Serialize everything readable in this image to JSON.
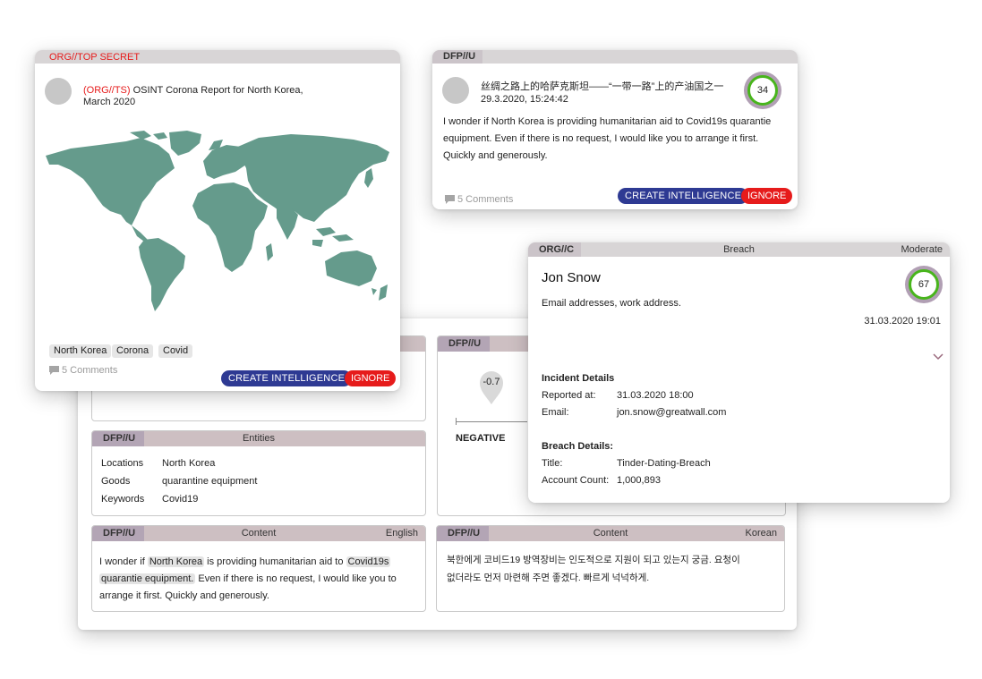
{
  "back_card": {
    "entities": {
      "cls": "DFP//U",
      "title": "Entities",
      "rows": [
        {
          "k": "Locations",
          "v": "North Korea"
        },
        {
          "k": "Goods",
          "v": "quarantine equipment"
        },
        {
          "k": "Keywords",
          "v": "Covid19"
        }
      ]
    },
    "content_en": {
      "cls": "DFP//U",
      "title": "Content",
      "lang": "English",
      "t1": "I wonder if ",
      "h1": "North Korea",
      "t2": " is providing humanitarian aid to ",
      "h2": "Covid19s",
      "h3": "quarantie equipment.",
      "t3": " Even if there is no request, I would like you to",
      "t4": "arrange it first. Quickly and generously."
    },
    "content_ko": {
      "cls": "DFP//U",
      "title": "Content",
      "lang": "Korean",
      "line1": "북한에게 코비드19 방역장비는 인도적으로 지원이 되고 있는지 궁금. 요청이",
      "line2": "없더라도 먼저 마련해 주면 좋겠다. 빠르게 넉넉하게."
    },
    "sentiment": {
      "cls": "DFP//U",
      "value": "-0.7",
      "label": "NEGATIVE"
    }
  },
  "report_card": {
    "classification": "ORG//TOP SECRET",
    "title_prefix": "(ORG//TS)",
    "title_line1": " OSINT Corona Report for North Korea,",
    "title_line2": "March 2020",
    "tags": [
      "North Korea",
      "Corona",
      "Covid"
    ],
    "comments": "5 Comments",
    "create_label": "CREATE INTELLIGENCE",
    "ignore_label": "IGNORE",
    "map_color": "#659b8c"
  },
  "post_card": {
    "classification": "DFP//U",
    "title": "丝绸之路上的哈萨克斯坦——“一带一路”上的产油国之一",
    "timestamp": "29.3.2020, 15:24:42",
    "score": "34",
    "body_line1": "I wonder if North Korea is providing humanitarian aid to Covid19s  quarantie",
    "body_line2": "equipment. Even if there is no request, I would like you to arrange it first.",
    "body_line3": "Quickly and generously.",
    "comments": "5 Comments",
    "create_label": "CREATE INTELLIGENCE",
    "ignore_label": "IGNORE"
  },
  "breach_card": {
    "classification": "ORG//C",
    "type": "Breach",
    "severity": "Moderate",
    "name": "Jon Snow",
    "score": "67",
    "summary": "Email addresses, work address.",
    "date": "31.03.2020 19:01",
    "incident_heading": "Incident Details",
    "reported_label": "Reported at:",
    "reported_value": "31.03.2020 18:00",
    "email_label": "Email:",
    "email_value": "jon.snow@greatwall.com",
    "breach_heading": "Breach Details:",
    "title_label": "Title:",
    "title_value": "Tinder-Dating-Breach",
    "count_label": "Account Count:",
    "count_value": "1,000,893"
  },
  "colors": {
    "primary_button": "#2e3a93",
    "ignore_button": "#e61b1b",
    "classification_red": "#e61b1b",
    "score_ring": "#48b51c"
  }
}
